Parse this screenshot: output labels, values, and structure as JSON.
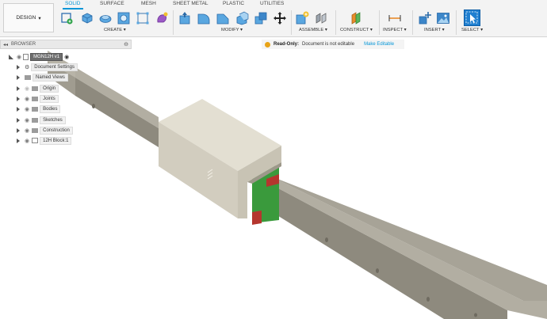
{
  "design_menu": {
    "label": "DESIGN"
  },
  "tabs": [
    "SOLID",
    "SURFACE",
    "MESH",
    "SHEET METAL",
    "PLASTIC",
    "UTILITIES"
  ],
  "groups": {
    "create": "CREATE",
    "modify": "MODIFY",
    "assemble": "ASSEMBLE",
    "construct": "CONSTRUCT",
    "inspect": "INSPECT",
    "insert": "INSERT",
    "select": "SELECT"
  },
  "browser": {
    "title": "BROWSER",
    "root": "MGN12H v1",
    "items": [
      "Document Settings",
      "Named Views",
      "Origin",
      "Joints",
      "Bodies",
      "Sketches",
      "Construction",
      "12H Block:1"
    ]
  },
  "readonly": {
    "title": "Read-Only:",
    "message": "Document is not editable",
    "action": "Make Editable"
  },
  "colors": {
    "accent": "#0696d7",
    "rail": "#9c988c",
    "block": "#d9d4c7",
    "green": "#3a9a3c",
    "red": "#b5362e"
  }
}
